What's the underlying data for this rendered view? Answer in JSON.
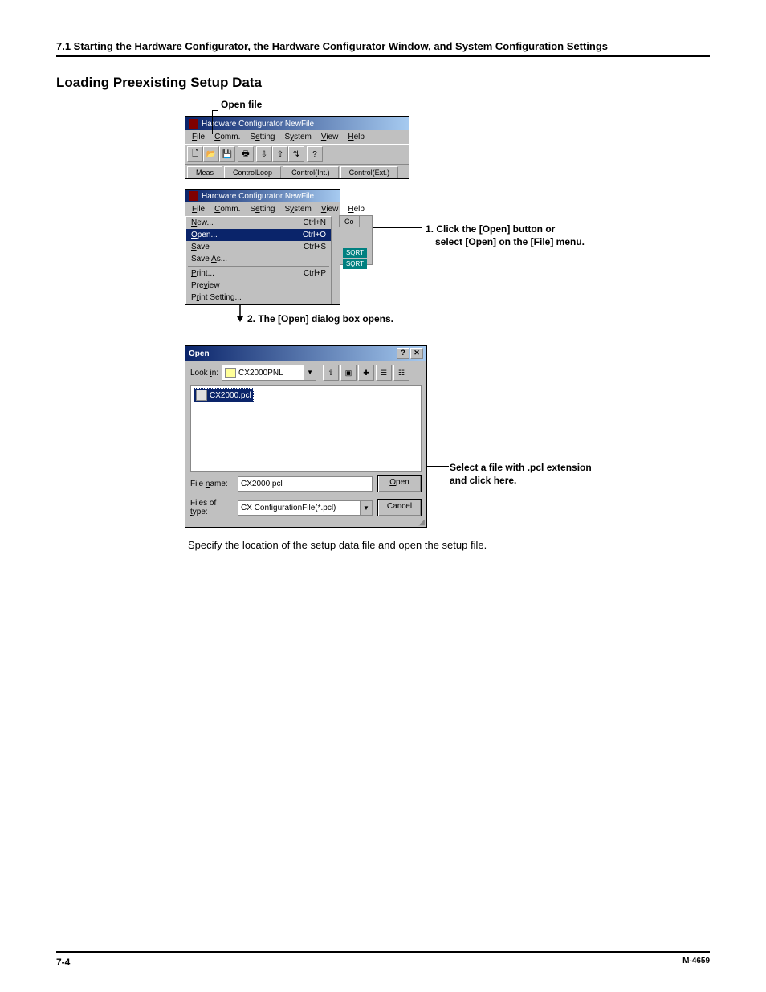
{
  "header": "7.1  Starting the Hardware Configurator, the Hardware Configurator Window, and System Configuration Settings",
  "section_title": "Loading Preexisting Setup Data",
  "callouts": {
    "open_file": "Open file",
    "step1_line1": "1. Click the [Open] button or",
    "step1_line2": "select [Open] on the [File] menu.",
    "step2": "2. The [Open] dialog box opens.",
    "step3_line1": "Select a file with .pcl extension",
    "step3_line2": "and click here."
  },
  "app": {
    "title": "Hardware Configurator NewFile",
    "menus": [
      "File",
      "Comm.",
      "Setting",
      "System",
      "View",
      "Help"
    ],
    "tabs": [
      "Meas",
      "ControlLoop",
      "Control(Int.)",
      "Control(Ext.)"
    ]
  },
  "filemenu": {
    "items": [
      {
        "label": "New...",
        "accel": "Ctrl+N"
      },
      {
        "label": "Open...",
        "accel": "Ctrl+O"
      },
      {
        "label": "Save",
        "accel": "Ctrl+S"
      },
      {
        "label": "Save As..."
      },
      {
        "divider": true
      },
      {
        "label": "Print...",
        "accel": "Ctrl+P"
      },
      {
        "label": "Preview"
      },
      {
        "label": "Print Setting..."
      }
    ],
    "sidetab": "Co",
    "sqrt": "SQRT"
  },
  "dialog": {
    "title": "Open",
    "look_in_label": "Look in:",
    "look_in_value": "CX2000PNL",
    "file_item": "CX2000.pcl",
    "file_name_label": "File name:",
    "file_name_value": "CX2000.pcl",
    "files_of_type_label": "Files of type:",
    "files_of_type_value": "CX ConfigurationFile(*.pcl)",
    "open_btn": "Open",
    "cancel_btn": "Cancel"
  },
  "caption": "Specify the location of the setup data file and open the setup file.",
  "footer": {
    "page": "7-4",
    "doc": "M-4659"
  }
}
